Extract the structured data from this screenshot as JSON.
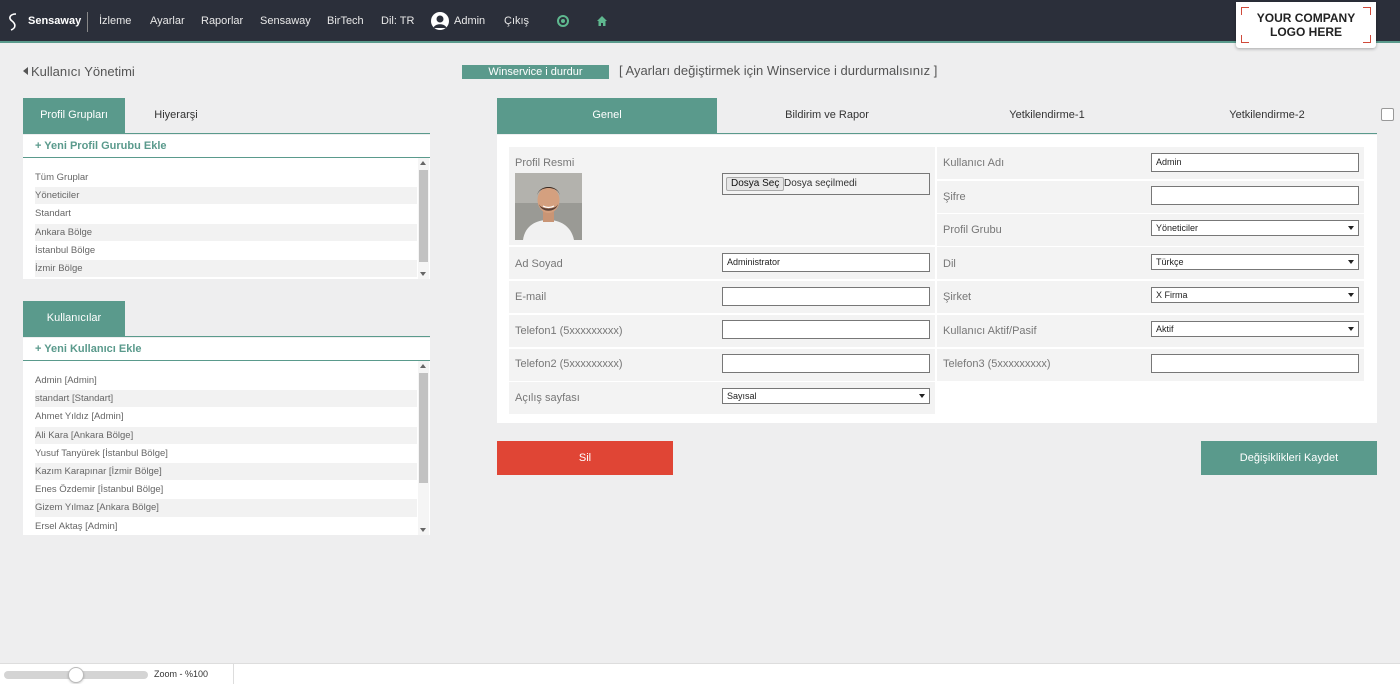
{
  "topbar": {
    "brand": "Sensaway",
    "nav": [
      "İzleme",
      "Ayarlar",
      "Raporlar",
      "Sensaway",
      "BirTech",
      "Dil: TR"
    ],
    "user": "Admin",
    "logout": "Çıkış",
    "company_logo": "YOUR COMPANY LOGO HERE"
  },
  "left": {
    "page_title": "Kullanıcı Yönetimi",
    "groups_tabs": [
      "Profil Grupları",
      "Hiyerarşi"
    ],
    "add_group": "+ Yeni Profil Gurubu Ekle",
    "groups": [
      "Tüm Gruplar",
      "Yöneticiler",
      "Standart",
      "Ankara Bölge",
      "İstanbul Bölge",
      "İzmir Bölge"
    ],
    "users_tab": "Kullanıcılar",
    "add_user": "+ Yeni Kullanıcı Ekle",
    "users": [
      "Admin [Admin]",
      "standart [Standart]",
      "Ahmet Yıldız [Admin]",
      "Ali Kara [Ankara Bölge]",
      "Yusuf Tanyürek [İstanbul Bölge]",
      "Kazım Karapınar [İzmir Bölge]",
      "Enes Özdemir [İstanbul Bölge]",
      "Gizem Yılmaz [Ankara Bölge]",
      "Ersel Aktaş [Admin]"
    ]
  },
  "winservice": {
    "button": "Winservice i durdur",
    "note": "[ Ayarları değiştirmek için Winservice i durdurmalısınız ]"
  },
  "tabs": [
    "Genel",
    "Bildirim ve Rapor",
    "Yetkilendirme-1",
    "Yetkilendirme-2"
  ],
  "form": {
    "profile_photo_label": "Profil Resmi",
    "file_button": "Dosya Seç",
    "file_status": "Dosya seçilmedi",
    "full_name_label": "Ad Soyad",
    "full_name_value": "Administrator",
    "email_label": "E-mail",
    "email_value": "",
    "phone1_label": "Telefon1 (5xxxxxxxxx)",
    "phone1_value": "",
    "phone2_label": "Telefon2 (5xxxxxxxxx)",
    "phone2_value": "",
    "home_page_label": "Açılış sayfası",
    "home_page_value": "Sayısal",
    "username_label": "Kullanıcı Adı",
    "username_value": "Admin",
    "password_label": "Şifre",
    "password_value": "",
    "profile_group_label": "Profil Grubu",
    "profile_group_value": "Yöneticiler",
    "language_label": "Dil",
    "language_value": "Türkçe",
    "company_label": "Şirket",
    "company_value": "X Firma",
    "active_label": "Kullanıcı Aktif/Pasif",
    "active_value": "Aktif",
    "phone3_label": "Telefon3 (5xxxxxxxxx)",
    "phone3_value": ""
  },
  "actions": {
    "delete": "Sil",
    "save": "Değişiklikleri Kaydet"
  },
  "footer": {
    "zoom_label": "Zoom - %100",
    "zoom_fraction": 0.5
  },
  "colors": {
    "accent": "#5a9a8c",
    "danger": "#e04535",
    "topbar": "#2b2f3a"
  }
}
